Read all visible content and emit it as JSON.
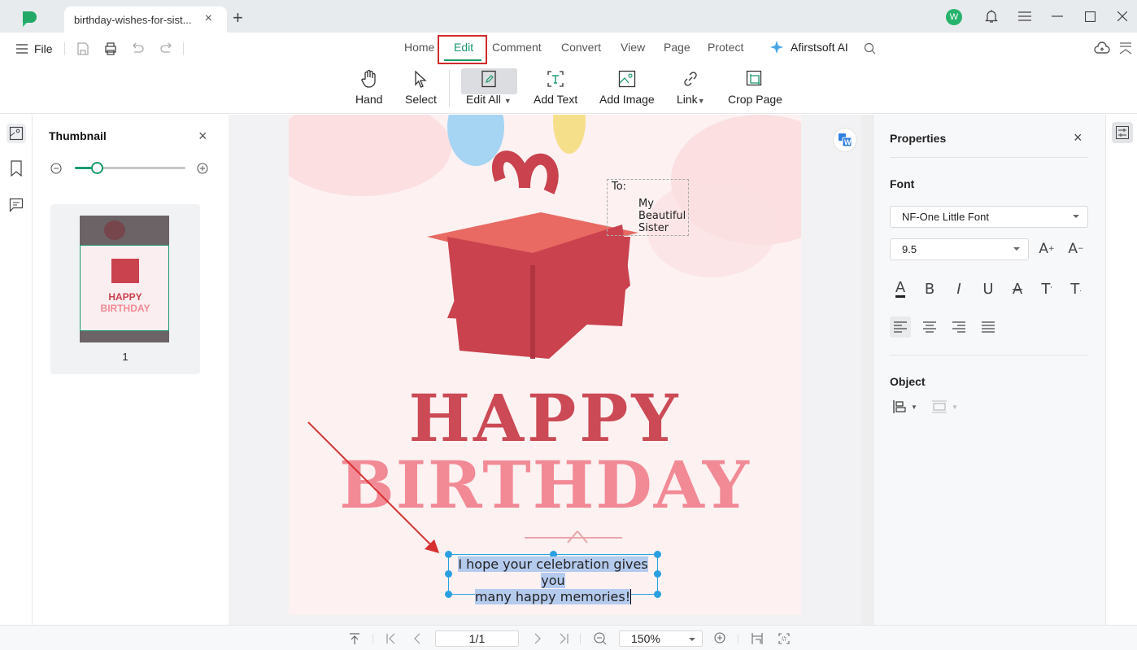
{
  "titlebar": {
    "tab_title": "birthday-wishes-for-sist...",
    "new_tab": "+",
    "avatar_letter": "W",
    "icons": [
      "bell-icon",
      "hamburger-icon",
      "minimize-icon",
      "maximize-icon",
      "close-icon"
    ]
  },
  "menubar": {
    "file_label": "File",
    "quick_icons": [
      "save-icon",
      "print-icon",
      "undo-icon",
      "redo-icon"
    ],
    "tabs": [
      {
        "label": "Home",
        "active": false
      },
      {
        "label": "Edit",
        "active": true
      },
      {
        "label": "Comment",
        "active": false
      },
      {
        "label": "Convert",
        "active": false
      },
      {
        "label": "View",
        "active": false
      },
      {
        "label": "Page",
        "active": false
      },
      {
        "label": "Protect",
        "active": false
      }
    ],
    "ai_label": "Afirstsoft AI",
    "accent": "#1a9a6a",
    "highlight_color": "#d02a2a"
  },
  "toolbar": {
    "tools": [
      {
        "label": "Hand",
        "icon": "hand-icon"
      },
      {
        "label": "Select",
        "icon": "cursor-icon"
      },
      {
        "label": "Edit All",
        "icon": "edit-all-icon",
        "active": true,
        "dropdown": true
      },
      {
        "label": "Add Text",
        "icon": "add-text-icon"
      },
      {
        "label": "Add Image",
        "icon": "add-image-icon"
      },
      {
        "label": "Link",
        "icon": "link-icon",
        "dropdown": true
      },
      {
        "label": "Crop Page",
        "icon": "crop-icon"
      }
    ]
  },
  "thumbnail_panel": {
    "title": "Thumbnail",
    "zoom_fraction": 0.2,
    "page_number": "1",
    "thumb_happy": "HAPPY",
    "thumb_birthday": "BIRTHDAY"
  },
  "document": {
    "to_label": "To:",
    "recipient_lines": [
      "My",
      "Beautiful",
      "Sister"
    ],
    "headline_1": "HAPPY",
    "headline_2": "BIRTHDAY",
    "message_line_1": "I hope your celebration gives you",
    "message_line_2": "many happy memories!",
    "headline_1_color": "#cc4a55",
    "headline_2_color": "#f28a96"
  },
  "properties": {
    "title": "Properties",
    "font_section": "Font",
    "font_family": "NF-One Little Font",
    "font_size": "9.5",
    "object_section": "Object",
    "format_icons": [
      "text-color-icon",
      "bold-icon",
      "italic-icon",
      "underline-icon",
      "strikethrough-icon",
      "superscript-icon",
      "subscript-icon"
    ],
    "align_icons": [
      "align-left-icon",
      "align-center-icon",
      "align-right-icon",
      "align-justify-icon"
    ],
    "align_active": "left"
  },
  "statusbar": {
    "page_value": "1/1",
    "zoom_value": "150%"
  }
}
